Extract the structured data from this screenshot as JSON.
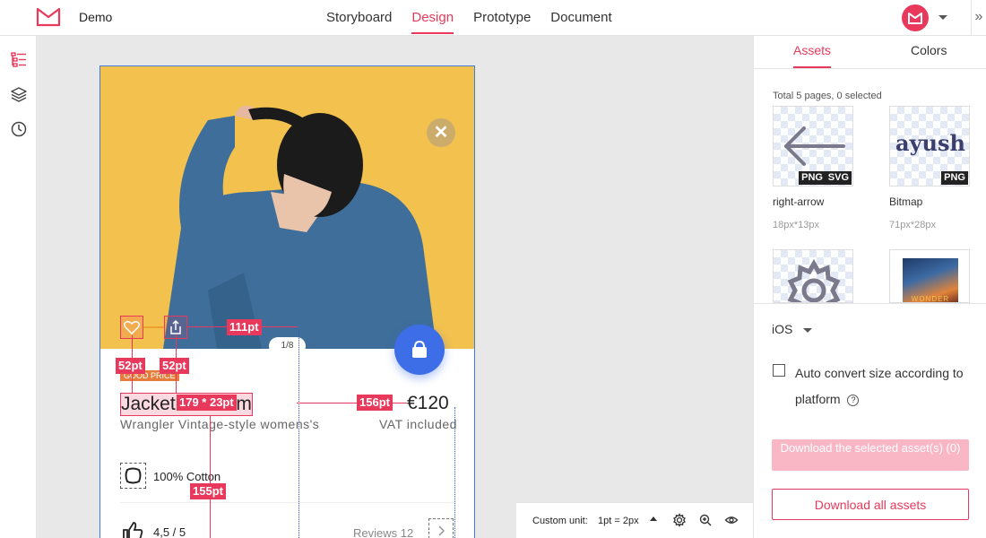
{
  "header": {
    "project_name": "Demo",
    "tabs": [
      {
        "label": "Storyboard",
        "active": false
      },
      {
        "label": "Design",
        "active": true
      },
      {
        "label": "Prototype",
        "active": false
      },
      {
        "label": "Document",
        "active": false
      }
    ],
    "collapse_glyph": "»",
    "accent_color": "#e8395c"
  },
  "artboard": {
    "close_glyph": "✕",
    "pager": "1/8",
    "badge": "GOOD PRICE",
    "product_title": "Jacket in denim",
    "price": "€120",
    "subtitle": "Wrangler Vintage-style womens's",
    "vat": "VAT included",
    "feature": "100% Cotton",
    "rating": "4,5 / 5",
    "reviews": "Reviews 12",
    "photo_color": "#f2c14e",
    "bag_color": "#3d6ee8"
  },
  "measurements": {
    "heart_width": "52pt",
    "share_width": "52pt",
    "icons_gap": "111pt",
    "title_size": "179 * 23pt",
    "title_to_price": "156pt",
    "title_to_feature": "155pt"
  },
  "unit_bar": {
    "label": "Custom unit:",
    "value": "1pt = 2px"
  },
  "right_panel": {
    "tabs": [
      {
        "label": "Assets",
        "active": true
      },
      {
        "label": "Colors",
        "active": false
      }
    ],
    "total": "Total 5 pages, 0 selected",
    "assets": [
      {
        "name": "right-arrow",
        "size": "18px*13px",
        "badges": [
          "PNG",
          "SVG"
        ],
        "icon": "arrow-left-icon"
      },
      {
        "name": "Bitmap",
        "size": "71px*28px",
        "badges": [
          "PNG"
        ],
        "icon": "ayush-logo",
        "logo_text": "ayush"
      },
      {
        "name": "",
        "size": "",
        "badges": [],
        "icon": "gear-icon"
      },
      {
        "name": "",
        "size": "",
        "badges": [],
        "icon": "poster-thumbnail",
        "poster_text": "WONDER"
      }
    ],
    "platform": "iOS",
    "auto_convert_label": "Auto convert size according to platform",
    "auto_convert_checked": false,
    "download_selected_label": "Download the selected asset(s) (0)",
    "download_all_label": "Download all assets"
  }
}
